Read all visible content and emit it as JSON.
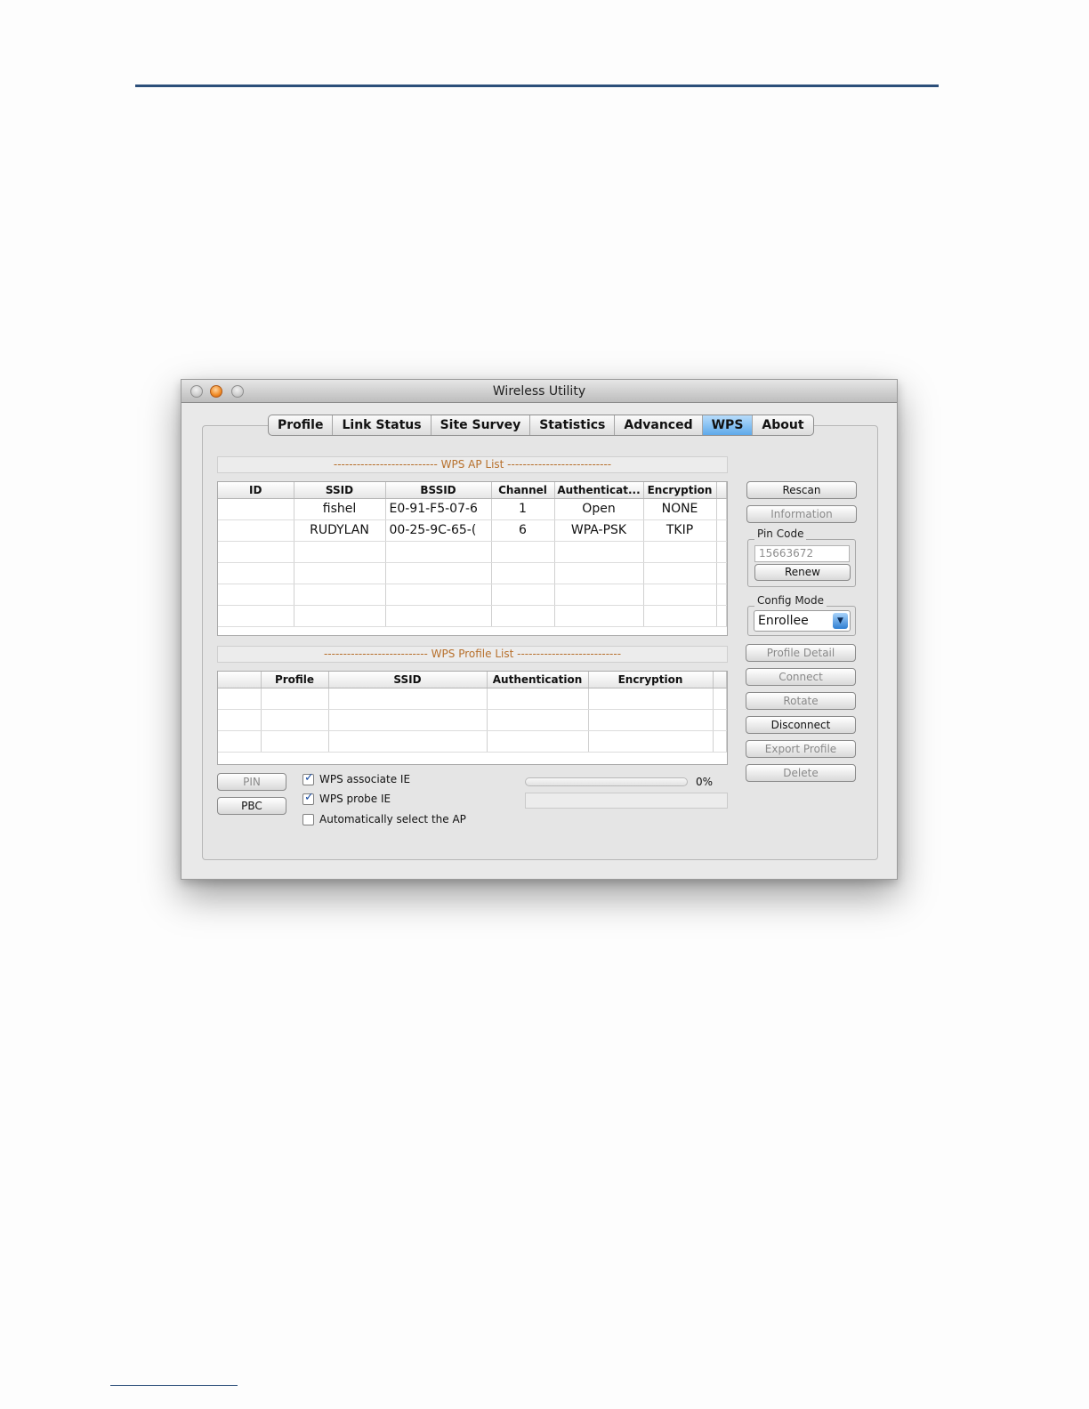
{
  "window": {
    "title": "Wireless Utility"
  },
  "tabs": [
    {
      "label": "Profile"
    },
    {
      "label": "Link Status"
    },
    {
      "label": "Site Survey"
    },
    {
      "label": "Statistics"
    },
    {
      "label": "Advanced"
    },
    {
      "label": "WPS",
      "active": true
    },
    {
      "label": "About"
    }
  ],
  "ap_list": {
    "header": "--------------------------- WPS AP List ---------------------------",
    "columns": [
      "ID",
      "SSID",
      "BSSID",
      "Channel",
      "Authenticat...",
      "Encryption"
    ],
    "rows": [
      [
        "",
        "fishel",
        "E0-91-F5-07-6",
        "1",
        "Open",
        "NONE"
      ],
      [
        "",
        "RUDYLAN",
        "00-25-9C-65-(",
        "6",
        "WPA-PSK",
        "TKIP"
      ]
    ]
  },
  "profile_list": {
    "header": "--------------------------- WPS Profile List ---------------------------",
    "columns": [
      "",
      "Profile",
      "SSID",
      "Authentication",
      "Encryption"
    ]
  },
  "buttons": {
    "rescan": "Rescan",
    "information": "Information",
    "renew": "Renew",
    "profile_detail": "Profile Detail",
    "connect": "Connect",
    "rotate": "Rotate",
    "disconnect": "Disconnect",
    "export_profile": "Export Profile",
    "delete": "Delete",
    "pin": "PIN",
    "pbc": "PBC"
  },
  "pin_code": {
    "label": "Pin Code",
    "value": "15663672"
  },
  "config_mode": {
    "label": "Config Mode",
    "value": "Enrollee"
  },
  "options": {
    "wps_associate_ie": {
      "label": "WPS associate IE",
      "checked": true
    },
    "wps_probe_ie": {
      "label": "WPS probe IE",
      "checked": true
    },
    "auto_select_ap": {
      "label": "Automatically select the AP",
      "checked": false
    }
  },
  "progress": {
    "value": 0,
    "text": "0%"
  },
  "colors": {
    "rule": "#2c4f7a",
    "active_tab": "#5ea9ea",
    "section_header_text": "#b7702c"
  }
}
